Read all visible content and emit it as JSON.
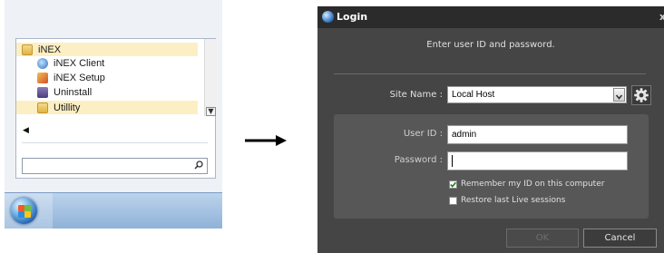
{
  "start_menu": {
    "items": [
      {
        "label": "iNEX",
        "icon": "folder-icon"
      },
      {
        "label": "iNEX Client",
        "icon": "inex-client-icon"
      },
      {
        "label": "iNEX Setup",
        "icon": "inex-setup-icon"
      },
      {
        "label": "Uninstall",
        "icon": "uninstall-icon"
      },
      {
        "label": "Utillity",
        "icon": "folder-icon"
      }
    ],
    "back_glyph": "◀",
    "scroll_glyph": "▼",
    "search_placeholder": ""
  },
  "login": {
    "title": "Login",
    "close_glyph": "x",
    "prompt": "Enter user ID and password.",
    "site_label": "Site Name :",
    "site_value": "Local Host",
    "user_label": "User ID :",
    "user_value": "admin",
    "password_label": "Password :",
    "password_value": "",
    "remember_label": "Remember my ID on this computer",
    "remember_checked": true,
    "restore_label": "Restore last Live sessions",
    "restore_checked": false,
    "ok_label": "OK",
    "cancel_label": "Cancel"
  },
  "colors": {
    "dialog_bg": "#454545",
    "highlight": "#fcefc4",
    "taskbar": "#8fb2d8"
  }
}
